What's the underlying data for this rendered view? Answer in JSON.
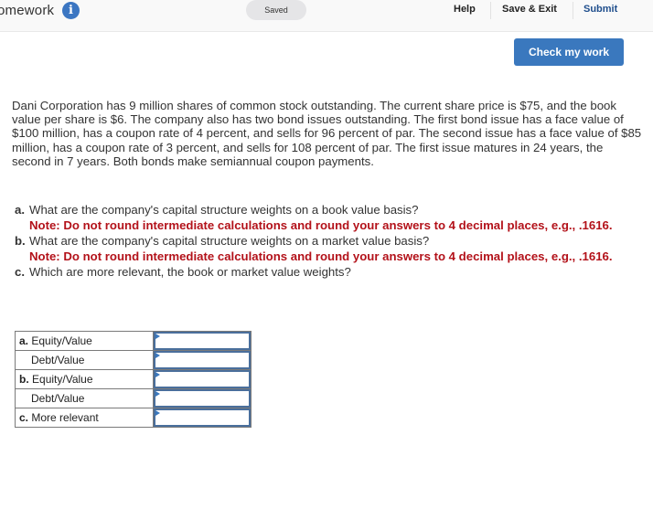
{
  "header": {
    "title": "omework",
    "info_icon": "info-icon",
    "saved_label": "Saved",
    "nav": {
      "help": "Help",
      "save_exit": "Save & Exit",
      "submit": "Submit"
    }
  },
  "check_button": "Check my work",
  "problem_text": "Dani Corporation has 9 million shares of common stock outstanding. The current share price is $75, and the book value per share is $6. The company also has two bond issues outstanding. The first bond issue has a face value of $100 million, has a coupon rate of 4 percent, and sells for 96 percent of par. The second issue has a face value of $85 million, has a coupon rate of 3 percent, and sells for 108 percent of par. The first issue matures in 24 years, the second in 7 years. Both bonds make semiannual coupon payments.",
  "questions": [
    {
      "letter": "a.",
      "text": "What are the company's capital structure weights on a book value basis?",
      "note": "Note: Do not round intermediate calculations and round your answers to 4 decimal places, e.g., .1616."
    },
    {
      "letter": "b.",
      "text": "What are the company's capital structure weights on a market value basis?",
      "note": "Note: Do not round intermediate calculations and round your answers to 4 decimal places, e.g., .1616."
    },
    {
      "letter": "c.",
      "text": "Which are more relevant, the book or market value weights?",
      "note": ""
    }
  ],
  "answer_table": {
    "rows": [
      {
        "prefix": "a.",
        "label": "Equity/Value",
        "value": ""
      },
      {
        "prefix": "",
        "label": "Debt/Value",
        "value": ""
      },
      {
        "prefix": "b.",
        "label": "Equity/Value",
        "value": ""
      },
      {
        "prefix": "",
        "label": "Debt/Value",
        "value": ""
      },
      {
        "prefix": "c.",
        "label": "More relevant",
        "value": ""
      }
    ]
  },
  "colors": {
    "accent_blue": "#3a78be",
    "note_red": "#b3121a",
    "submit_blue": "#1f4e8c"
  }
}
